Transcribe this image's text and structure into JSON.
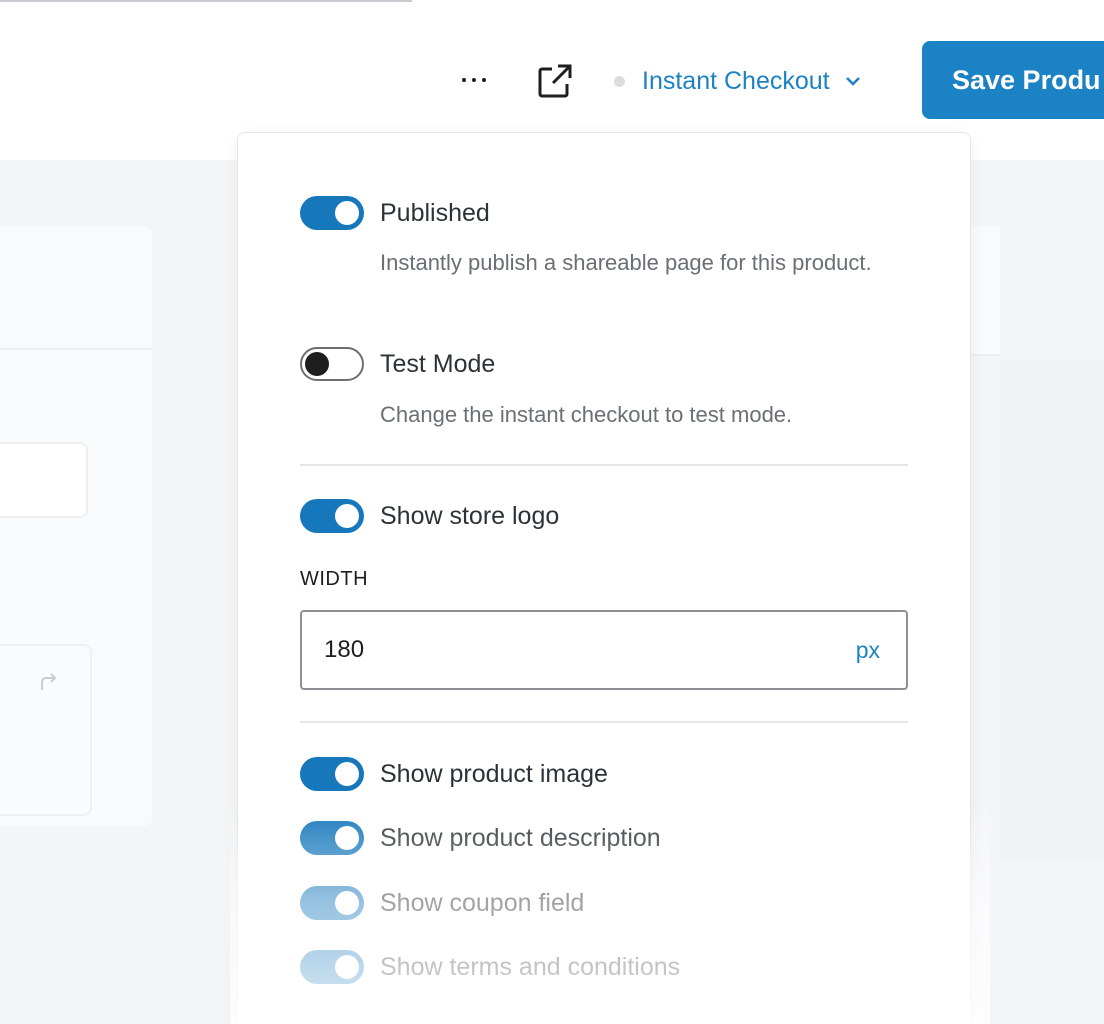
{
  "header": {
    "more_icon": "ellipsis-icon",
    "external_icon": "external-link-icon",
    "status_dot_color": "#dcdcde",
    "mode_dropdown_label": "Instant Checkout",
    "save_button_label": "Save Produ",
    "accent_color": "#1b82c4"
  },
  "panel": {
    "published": {
      "label": "Published",
      "enabled": true,
      "help": "Instantly publish a shareable page for this product."
    },
    "test_mode": {
      "label": "Test Mode",
      "enabled": false,
      "help": "Change the instant checkout to test mode."
    },
    "show_store_logo": {
      "label": "Show store logo",
      "enabled": true
    },
    "width": {
      "label": "WIDTH",
      "value": "180",
      "unit": "px"
    },
    "options": [
      {
        "label": "Show product image",
        "enabled": true
      },
      {
        "label": "Show product description",
        "enabled": true
      },
      {
        "label": "Show coupon field",
        "enabled": true
      },
      {
        "label": "Show terms and conditions",
        "enabled": true
      }
    ]
  }
}
